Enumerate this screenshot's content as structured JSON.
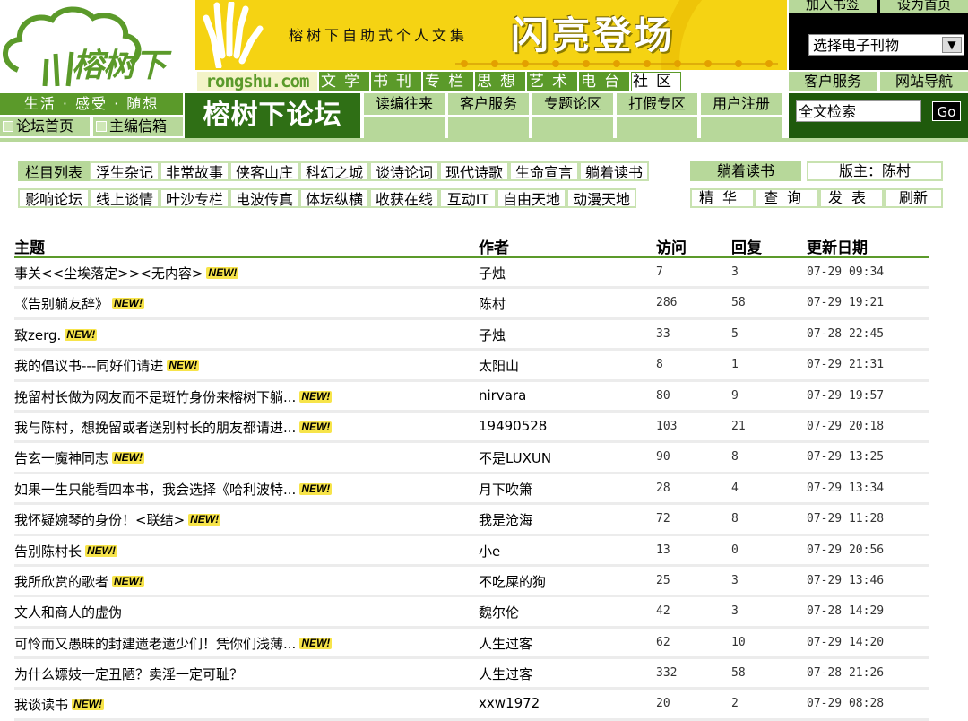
{
  "logo": {
    "text": "榕树下"
  },
  "banner": {
    "tagline": "榕树下自助式个人文集",
    "headline": "闪亮登场"
  },
  "site_domain": "rongshu.com",
  "channels": [
    "文学",
    "书刊",
    "专栏",
    "思想",
    "艺术",
    "电台",
    "社区"
  ],
  "top_links": {
    "join_bookmark": "加入书签",
    "set_home": "设为首页"
  },
  "magazine_select": {
    "value": "选择电子刊物"
  },
  "service_links": {
    "customer_service": "客户服务",
    "site_nav": "网站导航"
  },
  "slogan": "生活 · 感受 · 随想",
  "forum_links": {
    "home": "论坛首页",
    "mailbox": "主编信箱"
  },
  "forum_title": "榕树下论坛",
  "forum_nav": [
    "读编往来",
    "客户服务",
    "专题论区",
    "打假专区",
    "用户注册"
  ],
  "search": {
    "placeholder": "全文检索",
    "go": "Go"
  },
  "categories": {
    "label": "栏目列表",
    "row1": [
      "浮生杂记",
      "非常故事",
      "侠客山庄",
      "科幻之城",
      "谈诗论词",
      "现代诗歌",
      "生命宣言",
      "躺着读书"
    ],
    "row2": [
      "影响论坛",
      "线上谈情",
      "叶沙专栏",
      "电波传真",
      "体坛纵横",
      "收获在线",
      "互动IT",
      "自由天地",
      "动漫天地"
    ]
  },
  "board": {
    "name": "躺着读书",
    "moderator": "版主：陈村",
    "actions": [
      "精华",
      "查询",
      "发表",
      "刷新"
    ]
  },
  "table": {
    "headers": {
      "title": "主题",
      "author": "作者",
      "visits": "访问",
      "replies": "回复",
      "date": "更新日期"
    },
    "new_label": "NEW!",
    "rows": [
      {
        "title": "事关<<尘埃落定>><无内容>",
        "new": true,
        "author": "子烛",
        "visits": "7",
        "replies": "3",
        "date": "07-29 09:34"
      },
      {
        "title": "《告别躺友辞》",
        "new": true,
        "author": "陈村",
        "visits": "286",
        "replies": "58",
        "date": "07-29 19:21"
      },
      {
        "title": "致zerg.",
        "new": true,
        "author": "子烛",
        "visits": "33",
        "replies": "5",
        "date": "07-28 22:45"
      },
      {
        "title": "我的倡议书---同好们请进",
        "new": true,
        "author": "太阳山",
        "visits": "8",
        "replies": "1",
        "date": "07-29 21:31"
      },
      {
        "title": "挽留村长做为网友而不是斑竹身份来榕树下躺...",
        "new": true,
        "author": "nirvara",
        "visits": "80",
        "replies": "9",
        "date": "07-29 19:57"
      },
      {
        "title": "我与陈村，想挽留或者送别村长的朋友都请进...",
        "new": true,
        "author": "19490528",
        "visits": "103",
        "replies": "21",
        "date": "07-29 20:18"
      },
      {
        "title": "告玄一魔神同志",
        "new": true,
        "author": "不是LUXUN",
        "visits": "90",
        "replies": "8",
        "date": "07-29 13:25"
      },
      {
        "title": "如果一生只能看四本书，我会选择《哈利波特...",
        "new": true,
        "author": "月下吹箫",
        "visits": "28",
        "replies": "4",
        "date": "07-29 13:34"
      },
      {
        "title": "我怀疑婉琴的身份！<联结>",
        "new": true,
        "author": "我是沧海",
        "visits": "72",
        "replies": "8",
        "date": "07-29 11:28"
      },
      {
        "title": "告别陈村长",
        "new": true,
        "author": "小e",
        "visits": "13",
        "replies": "0",
        "date": "07-29 20:56"
      },
      {
        "title": "我所欣赏的歌者",
        "new": true,
        "author": "不吃屎的狗",
        "visits": "25",
        "replies": "3",
        "date": "07-29 13:46"
      },
      {
        "title": "文人和商人的虚伪",
        "new": false,
        "author": "魏尔伦",
        "visits": "42",
        "replies": "3",
        "date": "07-28 14:29"
      },
      {
        "title": "可怜而又愚昧的封建遗老遗少们！凭你们浅薄...",
        "new": true,
        "author": "人生过客",
        "visits": "62",
        "replies": "10",
        "date": "07-29 14:20"
      },
      {
        "title": "为什么嫖妓一定丑陋？卖淫一定可耻？",
        "new": false,
        "author": "人生过客",
        "visits": "332",
        "replies": "58",
        "date": "07-28 21:26"
      },
      {
        "title": "我谈读书",
        "new": true,
        "author": "xxw1972",
        "visits": "20",
        "replies": "2",
        "date": "07-29 08:28"
      }
    ]
  }
}
